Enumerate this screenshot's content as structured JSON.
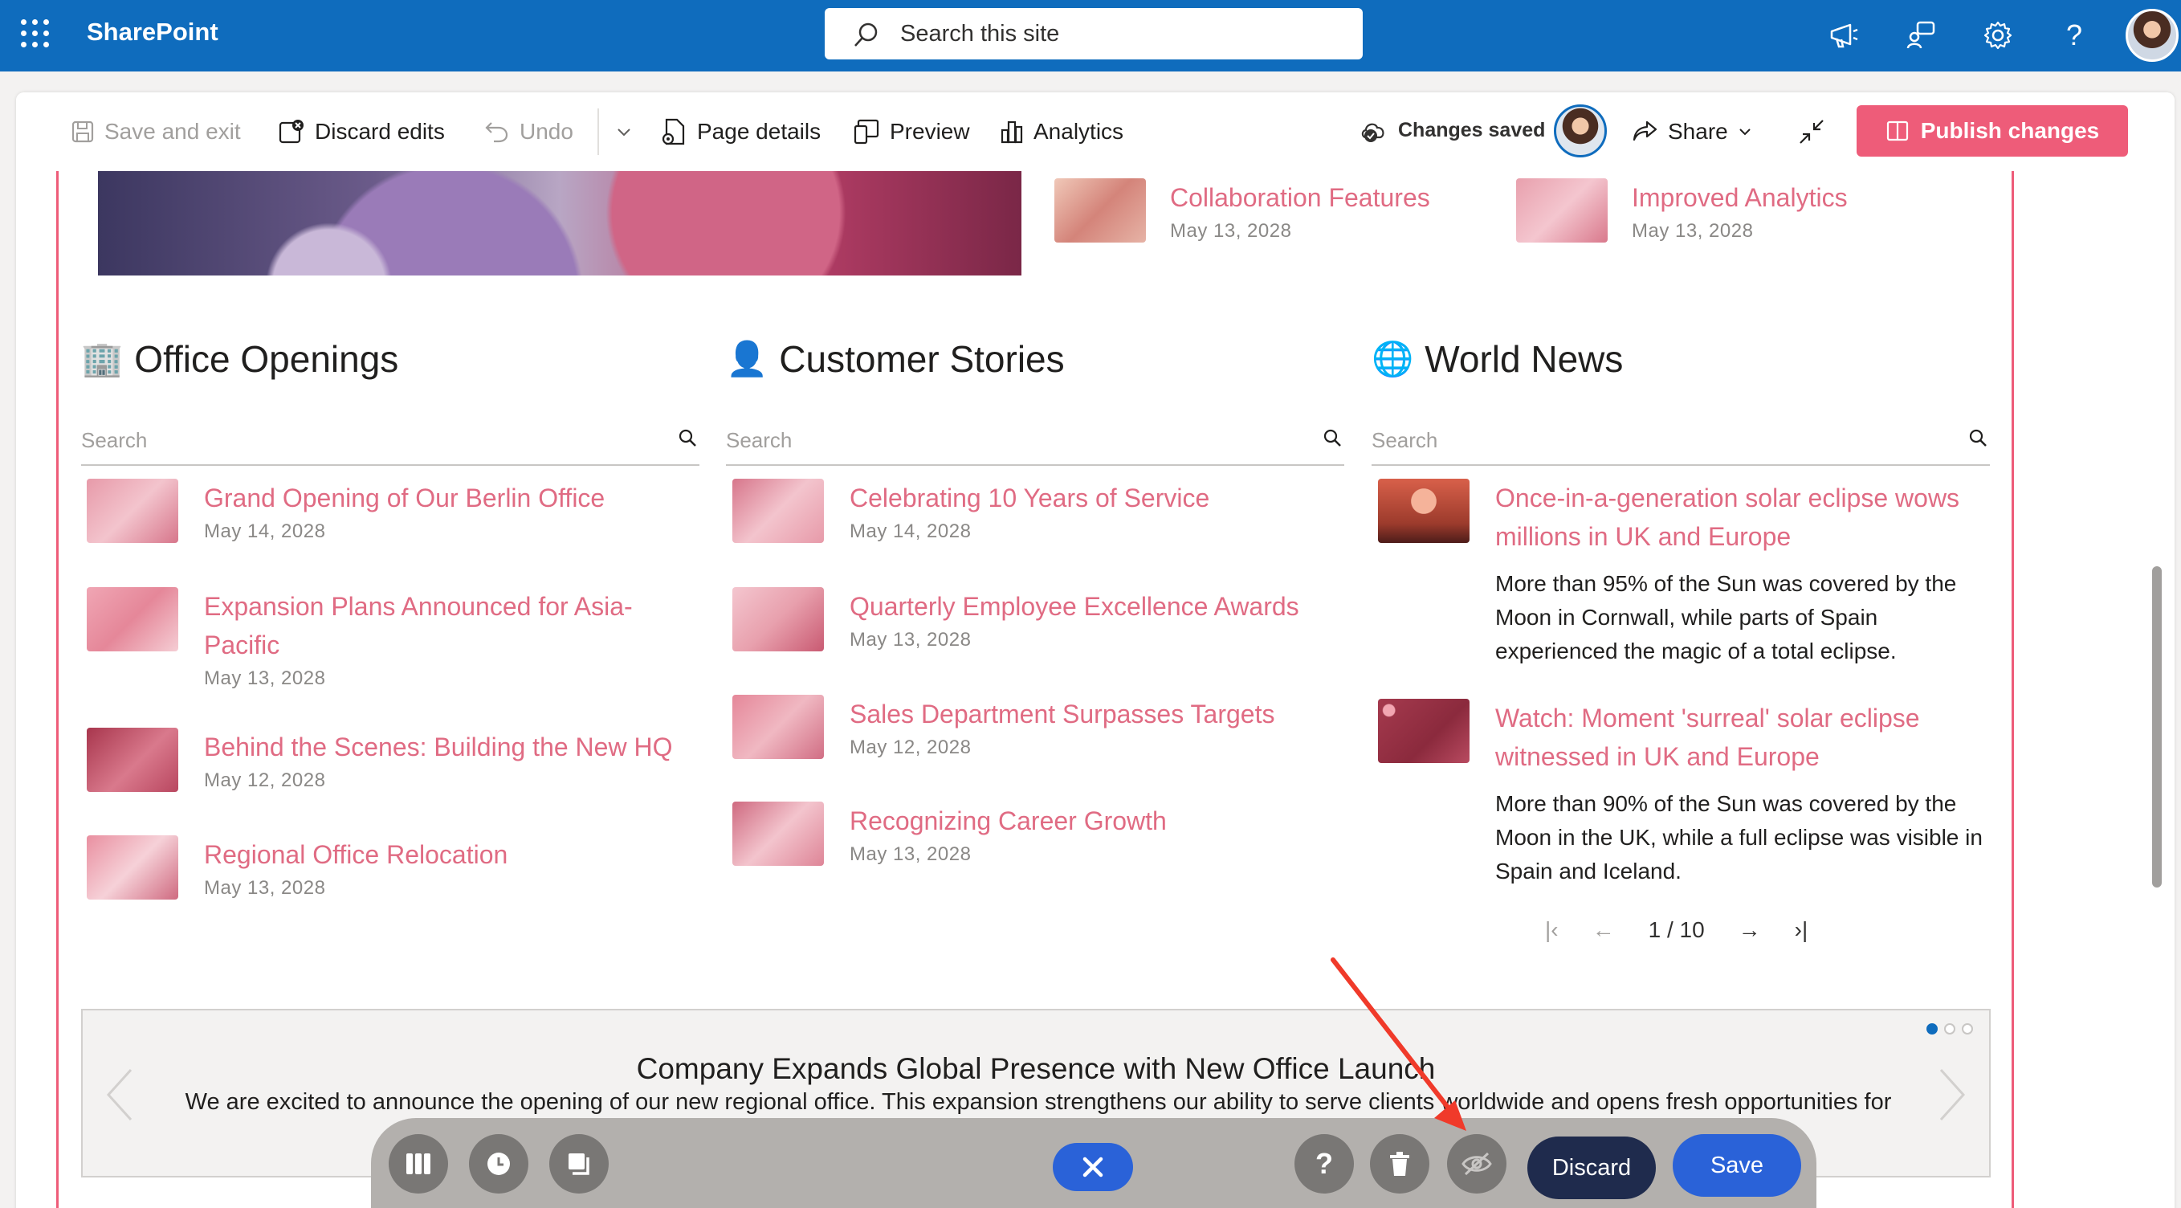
{
  "suite": {
    "brand": "SharePoint",
    "search_placeholder": "Search this site"
  },
  "cmdbar": {
    "save_exit": "Save and exit",
    "discard_edits": "Discard edits",
    "undo": "Undo",
    "page_details": "Page details",
    "preview": "Preview",
    "analytics": "Analytics",
    "status": "Changes saved",
    "share": "Share",
    "publish": "Publish changes"
  },
  "top_news": [
    {
      "title": "Collaboration Features",
      "date": "May 13, 2028"
    },
    {
      "title": "Improved Analytics",
      "date": "May 13, 2028"
    }
  ],
  "columns": {
    "office": {
      "title": "Office Openings",
      "emoji": "🏢",
      "search_placeholder": "Search",
      "items": [
        {
          "title": "Grand Opening of Our Berlin Office",
          "date": "May 14, 2028"
        },
        {
          "title": "Expansion Plans Announced for Asia-Pacific",
          "date": "May 13, 2028"
        },
        {
          "title": "Behind the Scenes: Building the New HQ",
          "date": "May 12, 2028"
        },
        {
          "title": "Regional Office Relocation",
          "date": "May 13, 2028"
        }
      ]
    },
    "customer": {
      "title": "Customer Stories",
      "emoji": "👤",
      "search_placeholder": "Search",
      "items": [
        {
          "title": "Celebrating 10 Years of Service",
          "date": "May 14, 2028"
        },
        {
          "title": "Quarterly Employee Excellence Awards",
          "date": "May 13, 2028"
        },
        {
          "title": "Sales Department Surpasses Targets",
          "date": "May 12, 2028"
        },
        {
          "title": "Recognizing Career Growth",
          "date": "May 13, 2028"
        }
      ]
    },
    "world": {
      "title": "World News",
      "emoji": "🌐",
      "search_placeholder": "Search",
      "items": [
        {
          "title": "Once-in-a-generation solar eclipse wows millions in UK and Europe",
          "desc": "More than 95% of the Sun was covered by the Moon in Cornwall, while parts of Spain experienced the magic of a total eclipse."
        },
        {
          "title": "Watch: Moment 'surreal' solar eclipse witnessed in UK and Europe",
          "desc": "More than 90% of the Sun was covered by the Moon in the UK, while a full eclipse was visible in Spain and Iceland."
        }
      ],
      "pager": "1 / 10"
    }
  },
  "carousel": {
    "title": "Company Expands Global Presence with New Office Launch",
    "body": "We are excited to announce the opening of our new regional office. This expansion strengthens our ability to serve clients worldwide and opens fresh opportunities for collaboration.",
    "active_slide": 1,
    "slide_count": 3
  },
  "float_toolbar": {
    "discard": "Discard",
    "save": "Save"
  },
  "colors": {
    "suite": "#0f6cbd",
    "accent": "#ee5c79",
    "link": "#e06b83",
    "primary": "#2a62d8"
  }
}
